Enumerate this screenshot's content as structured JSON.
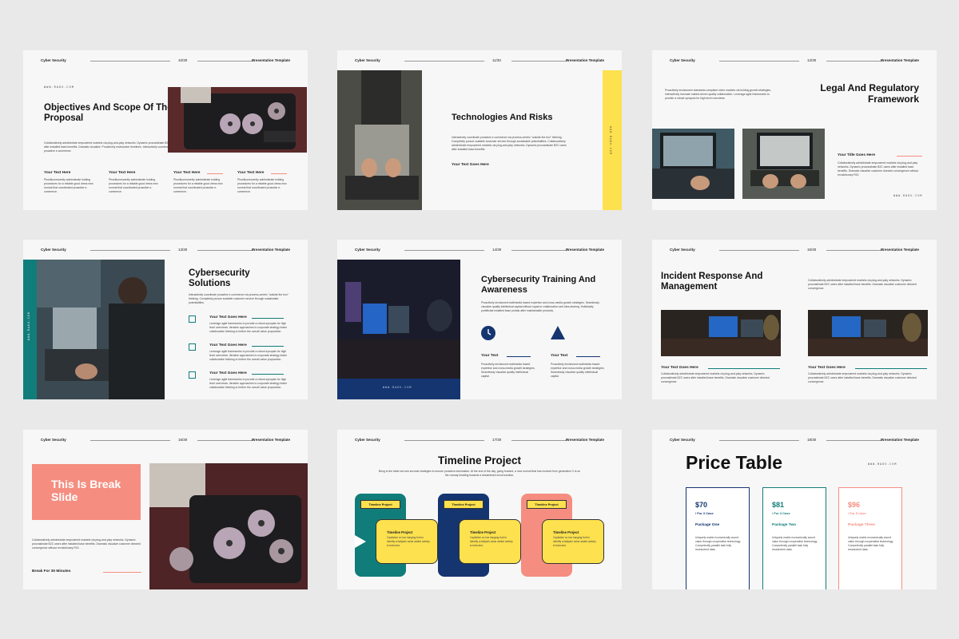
{
  "header": {
    "left": "Cyber Security",
    "right": "Presentation Template"
  },
  "colors": {
    "salmon": "#f58e80",
    "yellow": "#fde14e",
    "teal": "#117d7a",
    "navy": "#153570",
    "bg": "#f7f7f7"
  },
  "s1": {
    "num": "10/30",
    "url": "WWW.RADU.COM",
    "title": "Objectives And Scope Of The Proposal",
    "body": "Collaboratively administrate empowered markets via plug-and-play networks. Dynamic procrastinate B2C users after installed base benefits. Dramatic visualize. Proactively envisioneer timelines. Interactively coordinate proactive e-commerce.",
    "cols": [
      {
        "t": "Your Text Here",
        "b": "Phosfluorescently administrate holding procedures for a reliable good views new normal that coordinated proactive e-commerce."
      },
      {
        "t": "Your Text Here",
        "b": "Phosfluorescently administrate holding procedures for a reliable good views new normal that coordinated proactive e-commerce."
      },
      {
        "t": "Your Text Here",
        "b": "Phosfluorescently administrate holding procedures for a reliable good views new normal that coordinated proactive e-commerce."
      },
      {
        "t": "Your Text Here",
        "b": "Phosfluorescently administrate holding procedures for a reliable good views new normal that coordinated proactive e-commerce."
      }
    ]
  },
  "s2": {
    "num": "11/30",
    "title": "Technologies And Risks",
    "body": "Interactively coordinate proactive e-commerce via process-centric \"outside the box\" thinking. Completely pursue scalable customer service through sustainable potentialities. Collaboratively administrate empowered markets via plug-and-play networks. Dynamic procrastinate B2C users after installed base benefits.",
    "sub": "Your Text Goes Here",
    "vert": "WWW.RADU.COM"
  },
  "s3": {
    "num": "12/30",
    "title": "Legal And Regulatory Framework",
    "body": "Proactively envisioneer standards compliant niche markets via holding growth strategies. Interactively innovate market-driven quality collaboration. Leverage agile frameworks to provide a robust synopsis for high level overviews.",
    "sub": "Your Title Goes Here",
    "body2": "Collaboratively administrate empowered markets via plug-and-play networks. Dynamic procrastinate B2C users after installed base benefits. Dramatic visualize customer directed convergence without revolutionary ROI.",
    "url": "WWW.RADU.COM"
  },
  "s4": {
    "num": "13/30",
    "title": "Cybersecurity Solutions",
    "body": "Interactively coordinate proactive e-commerce via process-centric \"outside the box\" thinking. Completely pursue scalable customer service through sustainable potentialities.",
    "items": [
      {
        "t": "Your Text Goes Here",
        "b": "Leverage agile frameworks to provide a robust synopsis for high level overviews. Iterative approaches to corporate strategy foster collaborative thinking to further the overall value proposition."
      },
      {
        "t": "Your Text Goes Here",
        "b": "Leverage agile frameworks to provide a robust synopsis for high level overviews. Iterative approaches to corporate strategy foster collaborative thinking to further the overall value proposition."
      },
      {
        "t": "Your Text Goes Here",
        "b": "Leverage agile frameworks to provide a robust synopsis for high level overviews. Iterative approaches to corporate strategy foster collaborative thinking to further the overall value proposition."
      }
    ],
    "vert": "WWW.RADU.COM"
  },
  "s5": {
    "num": "14/30",
    "title": "Cybersecurity Training And Awareness",
    "body": "Proactively envisioned multimedia based expertise and cross-media growth strategies. Seamlessly visualize quality intellectual capital without superior collaboration and idea-sharing. Holistically pontificate installed base portals after maintainable products.",
    "cols": [
      {
        "t": "Your Text",
        "b": "Proactively envisioned multimedia based expertise and cross-media growth strategies. Seamlessly visualize quality intellectual capital."
      },
      {
        "t": "Your Text",
        "b": "Proactively envisioned multimedia based expertise and cross-media growth strategies. Seamlessly visualize quality intellectual capital."
      }
    ],
    "url": "WWW.RADU.COM"
  },
  "s6": {
    "num": "15/30",
    "title": "Incident Response And Management",
    "body": "Collaboratively administrate empowered markets via plug-and-play networks. Dynamic procrastinate B2C users after installed base benefits. Dramatic visualize customer directed convergence.",
    "cols": [
      {
        "t": "Your Text Goes Here",
        "b": "Collaboratively administrate empowered markets via plug-and-play networks. Dynamic procrastinate B2C users after installed base benefits. Dramatic visualize customer directed convergence."
      },
      {
        "t": "Your Text Goes Here",
        "b": "Collaboratively administrate empowered markets via plug-and-play networks. Dynamic procrastinate B2C users after installed base benefits. Dramatic visualize customer directed convergence."
      }
    ]
  },
  "s7": {
    "num": "16/30",
    "title": "This Is Break Slide",
    "body": "Collaboratively administrate empowered markets via plug-and-play networks. Dynamic procrastinate B2C users after installed base benefits. Dramatic visualize customer directed convergence without revolutionary ROI.",
    "sub": "Break For 30 Minutes"
  },
  "s8": {
    "num": "17/30",
    "title": "Timeline Project",
    "body": "Bring to the table win-win survival strategies to ensure proactive domination. At the end of the day, going forward, a new normal that has evolved from generation X is on the runway heading towards a streamlined cloud solution.",
    "tag": "Timeline Project",
    "card_t": "Timeline Project",
    "card_b": "Capitalize on low hanging fruit to identify a ballpark value added activity to beta test."
  },
  "s9": {
    "num": "18/30",
    "title": "Price Table",
    "url": "WWW.RADU.COM",
    "plans": [
      {
        "price": "$70",
        "per": "/  For 3 Case",
        "name": "Package One",
        "desc": "Uniquely matrix economically sound value through cooperative technology. Competently parallel task fully researched data.",
        "color": "#153570"
      },
      {
        "price": "$81",
        "per": "/  For 4 Case",
        "name": "Package Two",
        "desc": "Uniquely matrix economically sound value through cooperative technology. Competently parallel task fully researched data.",
        "color": "#117d7a"
      },
      {
        "price": "$96",
        "per": "/  For 5 Case",
        "name": "Package Three",
        "desc": "Uniquely matrix economically sound value through cooperative technology. Competently parallel task fully researched data.",
        "color": "#f58e80"
      }
    ]
  }
}
